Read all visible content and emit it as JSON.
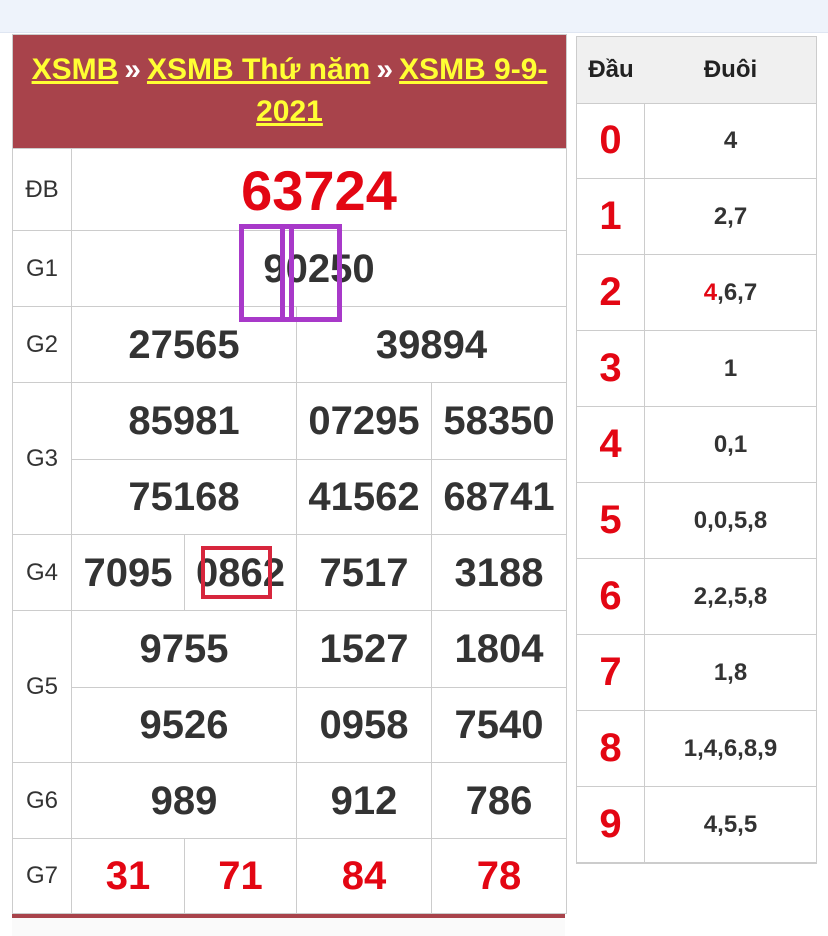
{
  "breadcrumb": {
    "crumbs": [
      "XSMB",
      "XSMB Thứ năm",
      "XSMB 9-9-2021"
    ],
    "separator": "»"
  },
  "prizes": {
    "db": {
      "label": "ĐB",
      "values": [
        "63724"
      ]
    },
    "g1": {
      "label": "G1",
      "values": [
        "90250"
      ]
    },
    "g2": {
      "label": "G2",
      "values": [
        "27565",
        "39894"
      ]
    },
    "g3": {
      "label": "G3",
      "values": [
        "85981",
        "07295",
        "58350",
        "75168",
        "41562",
        "68741"
      ]
    },
    "g4": {
      "label": "G4",
      "values": [
        "7095",
        "0862",
        "7517",
        "3188"
      ]
    },
    "g5": {
      "label": "G5",
      "values": [
        "9755",
        "1527",
        "1804",
        "9526",
        "0958",
        "7540"
      ]
    },
    "g6": {
      "label": "G6",
      "values": [
        "989",
        "912",
        "786"
      ]
    },
    "g7": {
      "label": "G7",
      "values": [
        "31",
        "71",
        "84",
        "78"
      ]
    }
  },
  "dau_duoi": {
    "head_label": "Đầu",
    "tail_label": "Đuôi",
    "rows": [
      {
        "dau": "0",
        "duoi_hl": "",
        "duoi": "4"
      },
      {
        "dau": "1",
        "duoi_hl": "",
        "duoi": "2,7"
      },
      {
        "dau": "2",
        "duoi_hl": "4",
        "duoi": ",6,7"
      },
      {
        "dau": "3",
        "duoi_hl": "",
        "duoi": "1"
      },
      {
        "dau": "4",
        "duoi_hl": "",
        "duoi": "0,1"
      },
      {
        "dau": "5",
        "duoi_hl": "",
        "duoi": "0,0,5,8"
      },
      {
        "dau": "6",
        "duoi_hl": "",
        "duoi": "2,2,5,8"
      },
      {
        "dau": "7",
        "duoi_hl": "",
        "duoi": "1,8"
      },
      {
        "dau": "8",
        "duoi_hl": "",
        "duoi": "1,4,6,8,9"
      },
      {
        "dau": "9",
        "duoi_hl": "",
        "duoi": "4,5,5"
      }
    ]
  },
  "colors": {
    "header_bg": "#a8434b",
    "link": "#ffff33",
    "accent_red": "#e30613",
    "highlight_purple": "#a839c9"
  }
}
